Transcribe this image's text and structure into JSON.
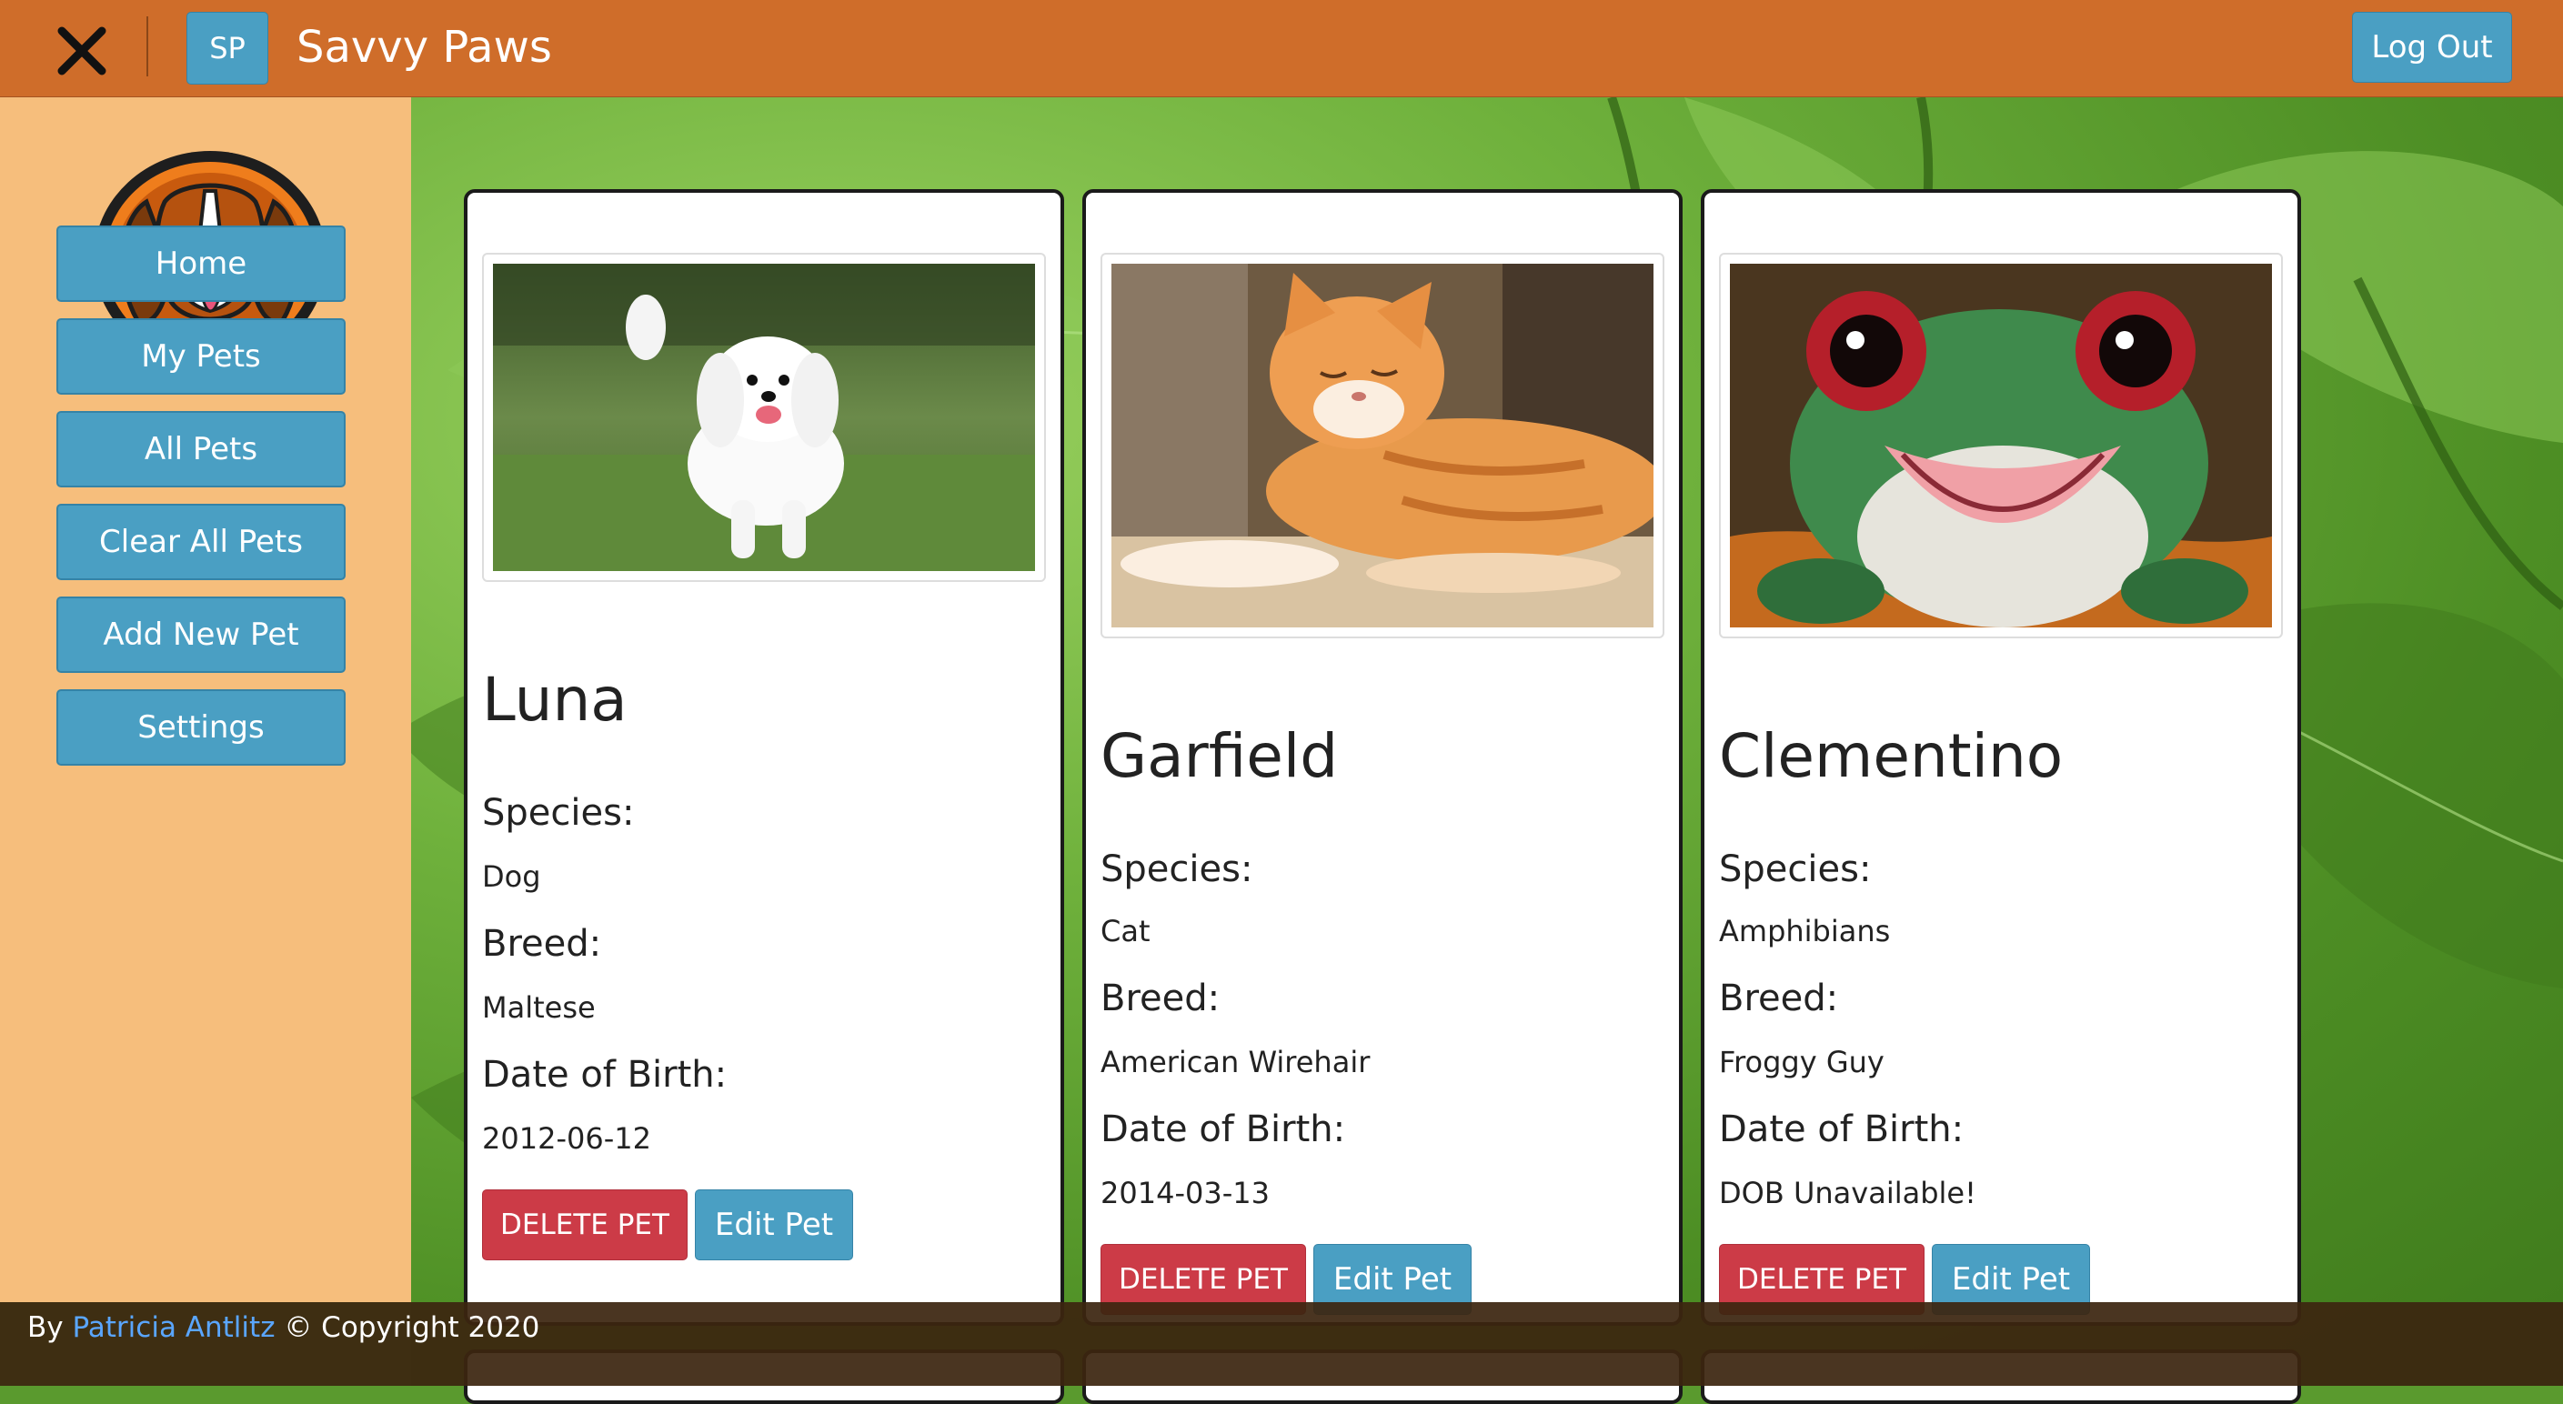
{
  "header": {
    "close_label": "✕",
    "badge": "SP",
    "title": "Savvy Paws",
    "logout_label": "Log Out"
  },
  "sidebar": {
    "items": [
      {
        "label": "Home"
      },
      {
        "label": "My Pets"
      },
      {
        "label": "All Pets"
      },
      {
        "label": "Clear All Pets"
      },
      {
        "label": "Add New Pet"
      },
      {
        "label": "Settings"
      }
    ]
  },
  "labels": {
    "species": "Species:",
    "breed": "Breed:",
    "dob": "Date of Birth:",
    "delete": "DELETE PET",
    "edit": "Edit Pet"
  },
  "pets": [
    {
      "name": "Luna",
      "species": "Dog",
      "breed": "Maltese",
      "dob": "2012-06-12"
    },
    {
      "name": "Garfield",
      "species": "Cat",
      "breed": "American Wirehair",
      "dob": "2014-03-13"
    },
    {
      "name": "Clementino",
      "species": "Amphibians",
      "breed": "Froggy Guy",
      "dob": "DOB Unavailable!"
    }
  ],
  "footer": {
    "by": "By",
    "author": "Patricia Antlitz",
    "copyright": "© Copyright 2020"
  },
  "colors": {
    "topbar": "#cf6d2a",
    "sidebar": "#f6be7c",
    "accent_button": "#4a9fc3",
    "danger_button": "#cc3b47",
    "footer": "#3c2610",
    "footer_link": "#5aa6ff"
  },
  "icons": {
    "close": "close-icon",
    "logo": "beagle-logo"
  }
}
